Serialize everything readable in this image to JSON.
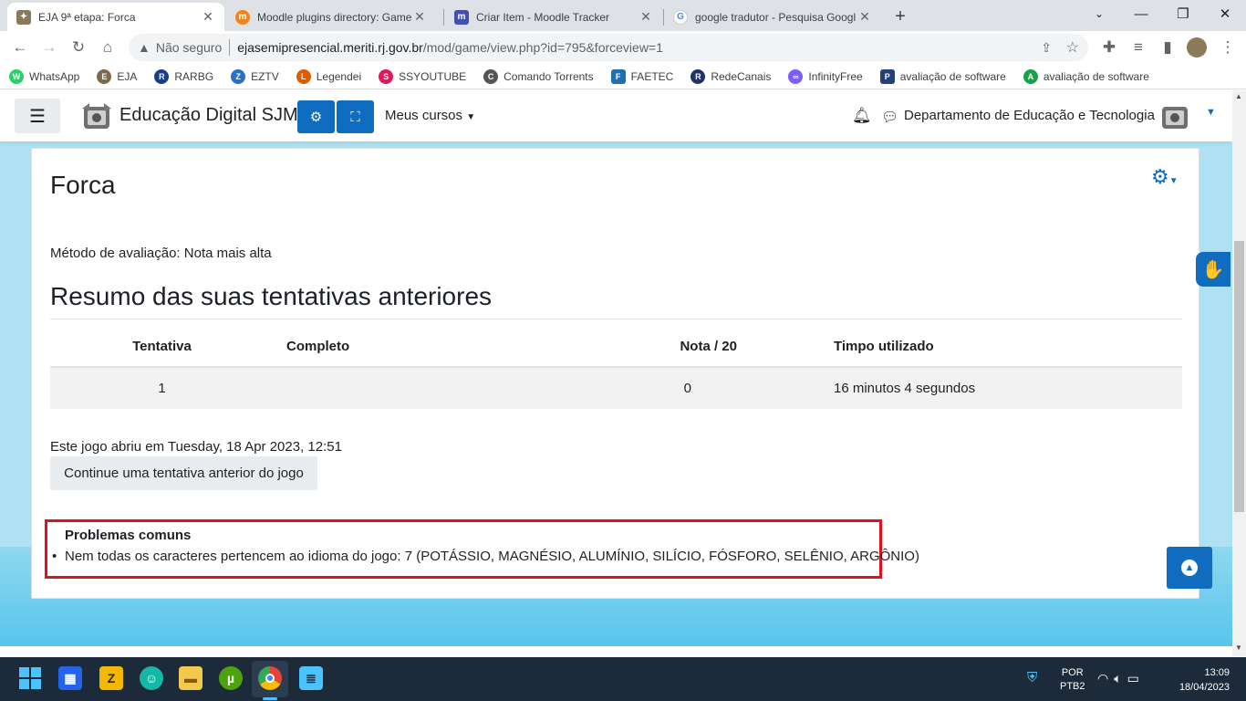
{
  "tabs": [
    {
      "title": "EJA 9ª etapa: Forca",
      "favicon": "eja-seal-icon",
      "active": true
    },
    {
      "title": "Moodle plugins directory: Game",
      "favicon": "moodle-icon",
      "active": false
    },
    {
      "title": "Criar Item - Moodle Tracker",
      "favicon": "moodle-tracker-icon",
      "active": false
    },
    {
      "title": "google tradutor - Pesquisa Googl",
      "favicon": "google-icon",
      "active": false
    }
  ],
  "window_controls": {
    "minimize": "—",
    "restore": "❐",
    "close": "✕"
  },
  "address_bar": {
    "security_label": "Não seguro",
    "host": "ejasemipresencial.meriti.rj.gov.br",
    "path": "/mod/game/view.php?id=795&forceview=1"
  },
  "bookmarks": [
    {
      "label": "WhatsApp",
      "color": "#25d366",
      "glyph": "W"
    },
    {
      "label": "EJA",
      "color": "#7d6a4a",
      "glyph": "E"
    },
    {
      "label": "RARBG",
      "color": "#1a3e8c",
      "glyph": "R"
    },
    {
      "label": "EZTV",
      "color": "#2a6fc9",
      "glyph": "Z"
    },
    {
      "label": "Legendei",
      "color": "#e05a00",
      "glyph": "L"
    },
    {
      "label": "SSYOUTUBE",
      "color": "#e0185a",
      "glyph": "S"
    },
    {
      "label": "Comando Torrents",
      "color": "#555555",
      "glyph": "C"
    },
    {
      "label": "FAETEC",
      "color": "#1f6fb5",
      "glyph": "F"
    },
    {
      "label": "RedeCanais",
      "color": "#223366",
      "glyph": "R"
    },
    {
      "label": "InfinityFree",
      "color": "#7a5cff",
      "glyph": "∞"
    },
    {
      "label": "avaliação de software",
      "color": "#23407a",
      "glyph": "P"
    },
    {
      "label": "avaliação de software",
      "color": "#16a34a",
      "glyph": "A"
    }
  ],
  "navbar": {
    "site_name": "Educação Digital SJM",
    "courses_label": "Meus cursos",
    "user_name": "Departamento de Educação e Tecnologia"
  },
  "page": {
    "title": "Forca",
    "grading_method": "Método de avaliação: Nota mais alta",
    "summary_heading": "Resumo das suas tentativas anteriores",
    "table": {
      "headers": [
        "Tentativa",
        "Completo",
        "Nota / 20",
        "Timpo utilizado"
      ],
      "rows": [
        [
          "1",
          "",
          "0",
          "16 minutos 4 segundos"
        ]
      ]
    },
    "opened_text": "Este jogo abriu em Tuesday, 18 Apr 2023, 12:51",
    "continue_button": "Continue uma tentativa anterior do jogo",
    "problems_title": "Problemas comuns",
    "problems_item": "Nem todas os caracteres pertencem ao idioma do jogo: 7 (POTÁSSIO, MAGNÉSIO, ALUMÍNIO, SILÍCIO, FÓSFORO, SELÊNIO, ARGÔNIO)"
  },
  "taskbar": {
    "lang_line1": "POR",
    "lang_line2": "PTB2",
    "time": "13:09",
    "date": "18/04/2023"
  },
  "colors": {
    "primary": "#0f6cbf",
    "highlight_border": "#e0101e",
    "taskbar": "#1c2a3a"
  }
}
